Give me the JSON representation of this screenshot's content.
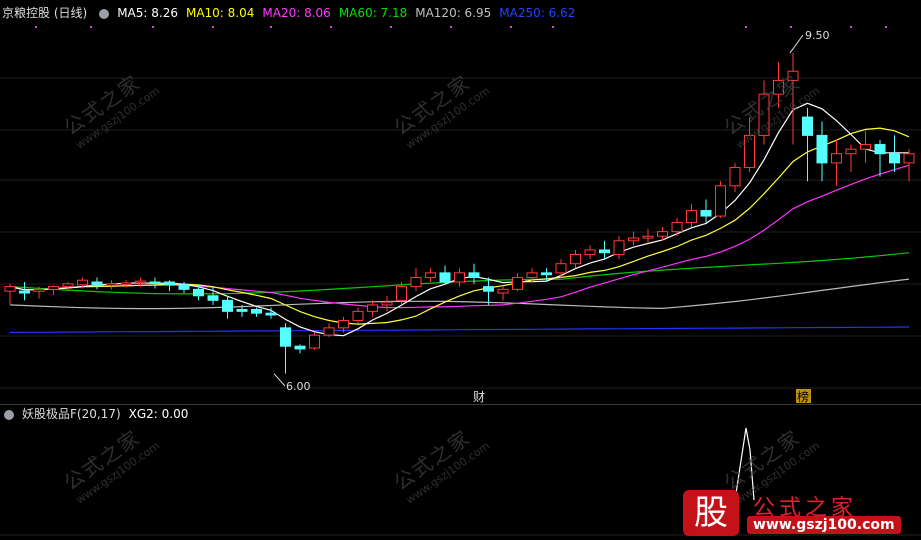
{
  "main_legend": {
    "title": "京粮控股 (日线)",
    "ma5": {
      "label": "MA5: 8.26",
      "color": "#ffffff"
    },
    "ma10": {
      "label": "MA10: 8.04",
      "color": "#ffff00"
    },
    "ma20": {
      "label": "MA20: 8.06",
      "color": "#ff00ff"
    },
    "ma60": {
      "label": "MA60: 7.18",
      "color": "#00ff00"
    },
    "ma120": {
      "label": "MA120: 6.95",
      "color": "#c0c0c0"
    },
    "ma250": {
      "label": "MA250: 6.62",
      "color": "#0000ff"
    }
  },
  "sub_legend": {
    "title": "妖股极品F(20,17)",
    "xg2": "XG2: 0.00"
  },
  "annotations": {
    "high_label": "9.50",
    "low_label": "6.00",
    "marker1": "财",
    "marker2": "榜"
  },
  "watermark": {
    "text": "公式之家",
    "url": "www.gszj100.com"
  },
  "logo": {
    "char": "股",
    "name": "公式之家",
    "url": "www.gszj100.com"
  },
  "chart_data": {
    "type": "candlestick",
    "price_range": [
      5.8,
      9.75
    ],
    "candles": [
      [
        6.9,
        6.98,
        6.95,
        6.75
      ],
      [
        6.9,
        7.0,
        6.88,
        6.8
      ],
      [
        6.9,
        6.95,
        6.92,
        6.82
      ],
      [
        6.92,
        6.96,
        6.95,
        6.86
      ],
      [
        6.95,
        7.0,
        6.98,
        6.9
      ],
      [
        6.97,
        7.05,
        7.02,
        6.93
      ],
      [
        7.0,
        7.05,
        6.96,
        6.92
      ],
      [
        6.98,
        7.02,
        6.98,
        6.92
      ],
      [
        6.98,
        7.02,
        6.99,
        6.94
      ],
      [
        7.0,
        7.05,
        7.01,
        6.95
      ],
      [
        7.0,
        7.05,
        6.99,
        6.93
      ],
      [
        7.0,
        7.02,
        6.97,
        6.9
      ],
      [
        6.97,
        7.0,
        6.92,
        6.88
      ],
      [
        6.92,
        6.97,
        6.85,
        6.8
      ],
      [
        6.85,
        6.95,
        6.8,
        6.75
      ],
      [
        6.8,
        6.85,
        6.68,
        6.6
      ],
      [
        6.7,
        6.75,
        6.68,
        6.62
      ],
      [
        6.7,
        6.72,
        6.66,
        6.62
      ],
      [
        6.66,
        6.72,
        6.64,
        6.6
      ],
      [
        6.5,
        6.55,
        6.3,
        6.0
      ],
      [
        6.3,
        6.32,
        6.27,
        6.22
      ],
      [
        6.28,
        6.45,
        6.42,
        6.26
      ],
      [
        6.42,
        6.55,
        6.5,
        6.4
      ],
      [
        6.5,
        6.62,
        6.58,
        6.45
      ],
      [
        6.58,
        6.72,
        6.68,
        6.55
      ],
      [
        6.68,
        6.8,
        6.75,
        6.62
      ],
      [
        6.75,
        6.85,
        6.78,
        6.68
      ],
      [
        6.8,
        7.0,
        6.95,
        6.75
      ],
      [
        6.95,
        7.15,
        7.05,
        6.9
      ],
      [
        7.05,
        7.15,
        7.1,
        7.0
      ],
      [
        7.1,
        7.18,
        7.0,
        6.98
      ],
      [
        7.0,
        7.15,
        7.1,
        6.95
      ],
      [
        7.1,
        7.2,
        7.05,
        6.98
      ],
      [
        6.95,
        7.05,
        6.9,
        6.75
      ],
      [
        6.88,
        6.95,
        6.92,
        6.8
      ],
      [
        6.92,
        7.1,
        7.05,
        6.9
      ],
      [
        7.05,
        7.15,
        7.1,
        7.0
      ],
      [
        7.1,
        7.15,
        7.08,
        7.0
      ],
      [
        7.1,
        7.25,
        7.2,
        7.05
      ],
      [
        7.2,
        7.35,
        7.3,
        7.15
      ],
      [
        7.3,
        7.4,
        7.35,
        7.25
      ],
      [
        7.35,
        7.45,
        7.32,
        7.25
      ],
      [
        7.3,
        7.5,
        7.45,
        7.25
      ],
      [
        7.45,
        7.55,
        7.48,
        7.4
      ],
      [
        7.48,
        7.58,
        7.5,
        7.42
      ],
      [
        7.5,
        7.6,
        7.55,
        7.45
      ],
      [
        7.55,
        7.7,
        7.65,
        7.5
      ],
      [
        7.65,
        7.85,
        7.78,
        7.6
      ],
      [
        7.78,
        7.9,
        7.72,
        7.65
      ],
      [
        7.72,
        8.1,
        8.05,
        7.7
      ],
      [
        8.05,
        8.3,
        8.25,
        7.98
      ],
      [
        8.25,
        8.8,
        8.6,
        8.2
      ],
      [
        8.6,
        9.2,
        9.05,
        8.5
      ],
      [
        9.05,
        9.4,
        9.2,
        8.9
      ],
      [
        9.2,
        9.5,
        9.3,
        8.5
      ],
      [
        8.8,
        8.9,
        8.6,
        8.1
      ],
      [
        8.6,
        8.75,
        8.3,
        8.1
      ],
      [
        8.3,
        8.55,
        8.4,
        8.05
      ],
      [
        8.4,
        8.5,
        8.45,
        8.2
      ],
      [
        8.45,
        8.65,
        8.5,
        8.3
      ],
      [
        8.5,
        8.55,
        8.4,
        8.15
      ],
      [
        8.4,
        8.6,
        8.3,
        8.2
      ],
      [
        8.3,
        8.45,
        8.4,
        8.1
      ]
    ]
  }
}
